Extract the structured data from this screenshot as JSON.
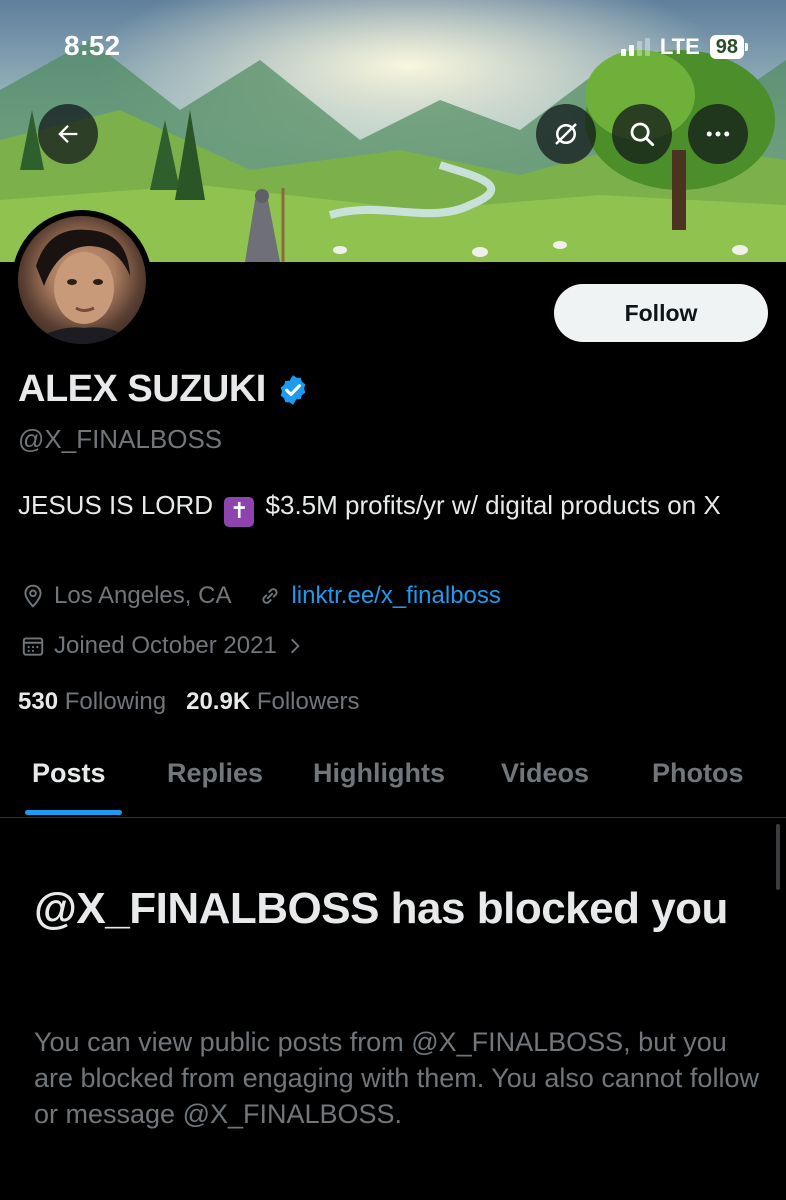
{
  "status_bar": {
    "time": "8:52",
    "network": "LTE",
    "battery": "98"
  },
  "profile": {
    "display_name": "ALEX SUZUKI",
    "handle": "@X_FINALBOSS",
    "bio_part1": "JESUS IS LORD",
    "bio_part2": "$3.5M profits/yr w/ digital products on X",
    "bio_emoji": "✝",
    "location": "Los Angeles, CA",
    "website": "linktr.ee/x_finalboss",
    "joined": "Joined October 2021",
    "following_count": "530",
    "following_label": "Following",
    "followers_count": "20.9K",
    "followers_label": "Followers",
    "verified_color": "#1d9bf0"
  },
  "actions": {
    "follow_label": "Follow"
  },
  "tabs": [
    {
      "label": "Posts",
      "active": true
    },
    {
      "label": "Replies"
    },
    {
      "label": "Highlights"
    },
    {
      "label": "Videos"
    },
    {
      "label": "Photos"
    }
  ],
  "blocked": {
    "title": "@X_FINALBOSS has blocked you",
    "description": "You can view public posts from @X_FINALBOSS, but you are blocked from engaging with them. You also cannot follow or message @X_FINALBOSS."
  },
  "icons": {
    "back": "arrow-left-icon",
    "hide": "eye-off-icon",
    "search": "search-icon",
    "more": "more-icon",
    "location": "location-pin-icon",
    "link": "link-icon",
    "calendar": "calendar-icon",
    "chevron": "chevron-right-icon",
    "verified": "verified-badge-icon"
  }
}
